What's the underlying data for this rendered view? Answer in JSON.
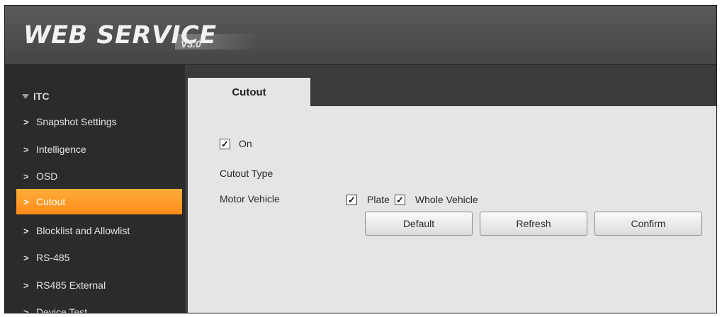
{
  "header": {
    "brand": "WEB  SERVICE",
    "version": "V3.0"
  },
  "sidebar": {
    "section": "ITC",
    "items": [
      {
        "label": "Snapshot Settings",
        "active": false
      },
      {
        "label": "Intelligence",
        "active": false
      },
      {
        "label": "OSD",
        "active": false
      },
      {
        "label": "Cutout",
        "active": true
      },
      {
        "label": "Blocklist and Allowlist",
        "active": false
      },
      {
        "label": "RS-485",
        "active": false
      },
      {
        "label": "RS485 External",
        "active": false
      },
      {
        "label": "Device Test",
        "active": false
      }
    ]
  },
  "tab": {
    "label": "Cutout"
  },
  "form": {
    "on_label": "On",
    "on_checked": true,
    "cutout_type_label": "Cutout Type",
    "motor_vehicle_label": "Motor Vehicle",
    "plate_label": "Plate",
    "plate_checked": true,
    "whole_vehicle_label": "Whole Vehicle",
    "whole_vehicle_checked": true
  },
  "buttons": {
    "default": "Default",
    "refresh": "Refresh",
    "confirm": "Confirm"
  },
  "colors": {
    "accent": "#ff9a26",
    "sidebar_bg": "#2b2b2b",
    "panel_bg": "#e5e5e5"
  }
}
